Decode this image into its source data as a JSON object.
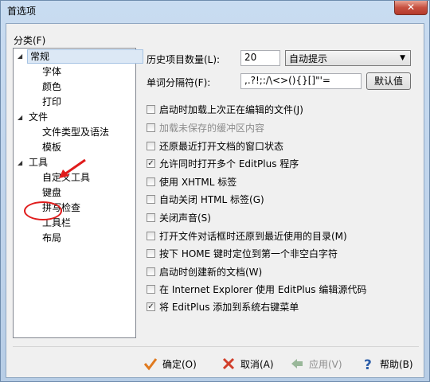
{
  "window": {
    "title": "首选项",
    "close_label": "✕"
  },
  "sidebar": {
    "label": "分类(F)",
    "items": [
      {
        "label": "常规"
      },
      {
        "label": "字体"
      },
      {
        "label": "颜色"
      },
      {
        "label": "打印"
      },
      {
        "label": "文件"
      },
      {
        "label": "文件类型及语法"
      },
      {
        "label": "模板"
      },
      {
        "label": "工具"
      },
      {
        "label": "自定义工具"
      },
      {
        "label": "键盘"
      },
      {
        "label": "拼写检查"
      },
      {
        "label": "工具栏"
      },
      {
        "label": "布局"
      }
    ]
  },
  "general": {
    "history_label": "历史项目数量(L):",
    "history_value": "20",
    "autocomplete_value": "自动提示",
    "separator_label": "单词分隔符(F):",
    "separator_value": ",.?!;:/\\<>(){}[]\"'=",
    "default_button": "默认值"
  },
  "options": [
    {
      "label": "启动时加载上次正在编辑的文件(J)",
      "checked": false,
      "disabled": false
    },
    {
      "label": "加载未保存的缓冲区内容",
      "checked": false,
      "disabled": true
    },
    {
      "label": "还原最近打开文档的窗口状态",
      "checked": false,
      "disabled": false
    },
    {
      "label": "允许同时打开多个 EditPlus 程序",
      "checked": true,
      "disabled": false
    },
    {
      "label": "使用 XHTML 标签",
      "checked": false,
      "disabled": false
    },
    {
      "label": "自动关闭 HTML 标签(G)",
      "checked": false,
      "disabled": false
    },
    {
      "label": "关闭声音(S)",
      "checked": false,
      "disabled": false
    },
    {
      "label": "打开文件对话框时还原到最近使用的目录(M)",
      "checked": false,
      "disabled": false
    },
    {
      "label": "按下 HOME 键时定位到第一个非空白字符",
      "checked": false,
      "disabled": false
    },
    {
      "label": "启动时创建新的文档(W)",
      "checked": false,
      "disabled": false
    },
    {
      "label": "在 Internet Explorer 使用 EditPlus 编辑源代码",
      "checked": false,
      "disabled": false
    },
    {
      "label": "将 EditPlus 添加到系统右键菜单",
      "checked": true,
      "disabled": false
    }
  ],
  "footer": {
    "ok": "确定(O)",
    "cancel": "取消(A)",
    "apply": "应用(V)",
    "help": "帮助(B)"
  },
  "colors": {
    "ok_icon": "#e07a1f",
    "cancel_icon": "#d13f2b",
    "apply_icon": "#9ab89a",
    "help_icon": "#2c5da8",
    "annotation": "#e01c1c"
  }
}
